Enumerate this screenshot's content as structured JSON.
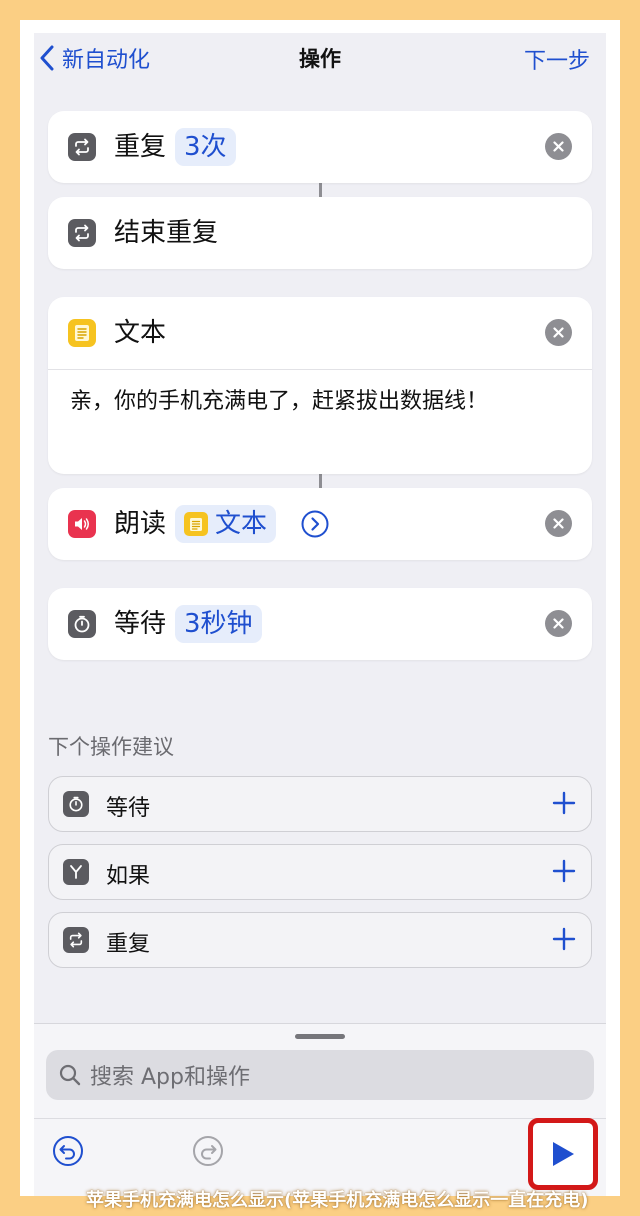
{
  "nav": {
    "back_label": "新自动化",
    "title": "操作",
    "next_label": "下一步"
  },
  "actions": {
    "repeat": {
      "label": "重复",
      "count_token": "3次"
    },
    "end_repeat": {
      "label": "结束重复"
    },
    "text": {
      "label": "文本",
      "body": "亲，你的手机充满电了，赶紧拔出数据线！"
    },
    "speak": {
      "label": "朗读",
      "input_token": "文本"
    },
    "wait": {
      "label": "等待",
      "duration_token": "3秒钟"
    }
  },
  "suggestions": {
    "heading": "下个操作建议",
    "items": [
      {
        "label": "等待",
        "icon": "timer-icon"
      },
      {
        "label": "如果",
        "icon": "branch-icon"
      },
      {
        "label": "重复",
        "icon": "repeat-icon"
      }
    ]
  },
  "search": {
    "placeholder": "搜索 App和操作"
  },
  "watermark": "苹果手机充满电怎么显示(苹果手机充满电怎么显示一直在充电)",
  "colors": {
    "accent": "#1f4fcf",
    "highlight_border": "#d31818",
    "page_background": "#fbcf84"
  }
}
